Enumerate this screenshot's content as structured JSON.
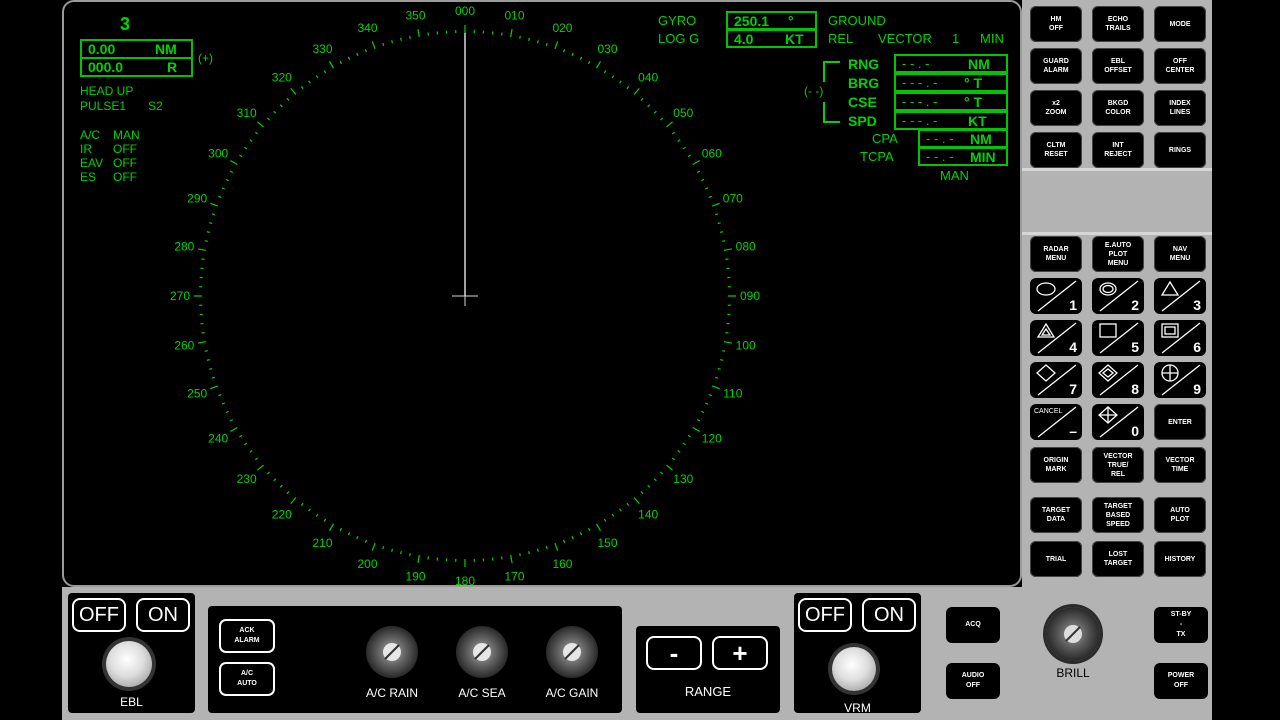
{
  "screen": {
    "range_scale": "3",
    "vrm_value": "0.00",
    "vrm_unit": "NM",
    "ebl_value": "000.0",
    "ebl_unit": "R",
    "plus_indicator": "(+)",
    "orientation": "HEAD UP",
    "pulse": "PULSE1",
    "pulse_code": "S2",
    "controls": [
      {
        "name": "A/C",
        "value": "MAN"
      },
      {
        "name": "IR",
        "value": "OFF"
      },
      {
        "name": "EAV",
        "value": "OFF"
      },
      {
        "name": "ES",
        "value": "OFF"
      }
    ],
    "gyro_label": "GYRO",
    "gyro_value": "250.1",
    "gyro_unit": "°",
    "log_label": "LOG G",
    "log_value": "4.0",
    "log_unit": "KT",
    "stab_mode": "GROUND",
    "vector_mode": "REL",
    "vector_label": "VECTOR",
    "vector_time": "1",
    "vector_unit": "MIN",
    "target_marker": "(- -)",
    "target_data": [
      {
        "label": "RNG",
        "value": "- - . -",
        "unit": "NM"
      },
      {
        "label": "BRG",
        "value": "- - - . -",
        "unit": "° T"
      },
      {
        "label": "CSE",
        "value": "- - - . -",
        "unit": "° T"
      },
      {
        "label": "SPD",
        "value": "- - - . -",
        "unit": "KT"
      }
    ],
    "cpa_label": "CPA",
    "cpa_value": "- - . -",
    "cpa_unit": "NM",
    "tcpa_label": "TCPA",
    "tcpa_value": "- - . -",
    "tcpa_unit": "MIN",
    "acq_mode": "MAN",
    "bearing_labels": [
      "000",
      "010",
      "020",
      "030",
      "040",
      "050",
      "060",
      "070",
      "080",
      "090",
      "100",
      "110",
      "120",
      "130",
      "140",
      "150",
      "160",
      "170",
      "180",
      "190",
      "200",
      "210",
      "220",
      "230",
      "240",
      "250",
      "260",
      "270",
      "280",
      "290",
      "300",
      "310",
      "320",
      "330",
      "340",
      "350"
    ]
  },
  "panel": {
    "top_buttons": [
      [
        "HM",
        "OFF"
      ],
      [
        "ECHO",
        "TRAILS"
      ],
      [
        "MODE"
      ],
      [
        "GUARD",
        "ALARM"
      ],
      [
        "EBL",
        "OFFSET"
      ],
      [
        "OFF",
        "CENTER"
      ],
      [
        "x2",
        "ZOOM"
      ],
      [
        "BKGD",
        "COLOR"
      ],
      [
        "INDEX",
        "LINES"
      ],
      [
        "CLTM",
        "RESET"
      ],
      [
        "INT",
        "REJECT"
      ],
      [
        "RINGS"
      ]
    ],
    "menu_buttons": [
      [
        "RADAR",
        "MENU"
      ],
      [
        "E.AUTO",
        "PLOT",
        "MENU"
      ],
      [
        "NAV",
        "MENU"
      ]
    ],
    "keypad": [
      "1",
      "2",
      "3",
      "4",
      "5",
      "6",
      "7",
      "8",
      "9",
      "–",
      "0"
    ],
    "cancel_label": "CANCEL",
    "enter_label": "ENTER",
    "lower_buttons": [
      [
        "ORIGIN",
        "MARK"
      ],
      [
        "VECTOR",
        "TRUE/",
        "REL"
      ],
      [
        "VECTOR",
        "TIME"
      ],
      [
        "TARGET",
        "DATA"
      ],
      [
        "TARGET",
        "BASED",
        "SPEED"
      ],
      [
        "AUTO",
        "PLOT"
      ],
      [
        "TRIAL"
      ],
      [
        "LOST",
        "TARGET"
      ],
      [
        "HISTORY"
      ]
    ]
  },
  "bottom": {
    "ebl_off": "OFF",
    "ebl_on": "ON",
    "ebl_label": "EBL",
    "ack_alarm": [
      "ACK",
      "ALARM"
    ],
    "ac_auto": [
      "A/C",
      "AUTO"
    ],
    "knobs": [
      "A/C RAIN",
      "A/C SEA",
      "A/C GAIN"
    ],
    "range_minus": "-",
    "range_plus": "+",
    "range_label": "RANGE",
    "vrm_off": "OFF",
    "vrm_on": "ON",
    "vrm_label": "VRM",
    "acq": "ACQ",
    "audio_off": [
      "AUDIO",
      "OFF"
    ],
    "brill_label": "BRILL",
    "stby_tx": [
      "ST-BY",
      "-",
      "TX"
    ],
    "power_off": [
      "POWER",
      "OFF"
    ]
  },
  "colors": {
    "phosphor": "#00d400",
    "panel": "#b3b3b3"
  }
}
